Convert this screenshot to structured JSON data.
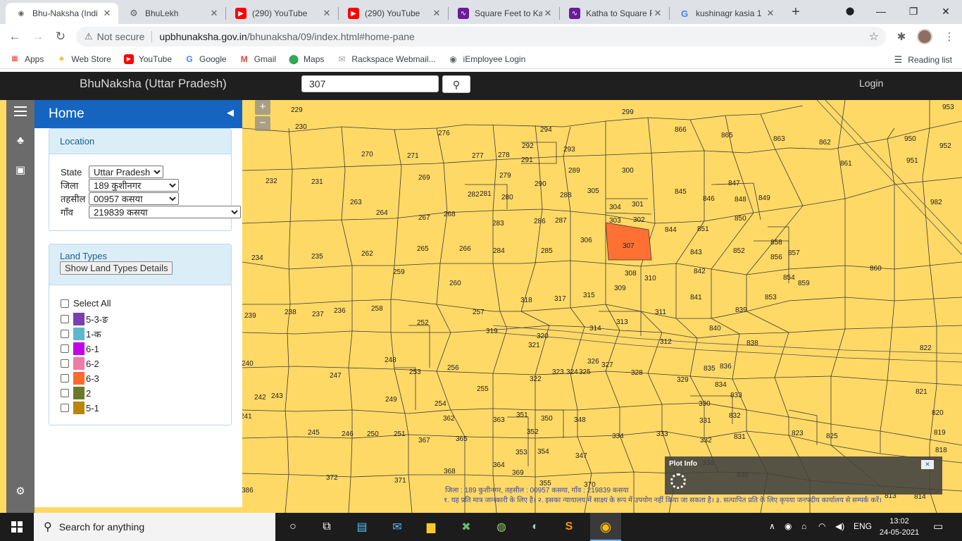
{
  "browser": {
    "tabs": [
      {
        "title": "Bhu-Naksha (Indi",
        "icon": "globe-icon",
        "color": "#5f6368"
      },
      {
        "title": "BhuLekh",
        "icon": "gear-icon",
        "color": "#5f6368"
      },
      {
        "title": "(290) YouTube",
        "icon": "youtube-icon",
        "color": "#ff0000"
      },
      {
        "title": "(290) YouTube",
        "icon": "youtube-icon",
        "color": "#ff0000"
      },
      {
        "title": "Square Feet to Ka",
        "icon": "converter-icon",
        "color": "#6a1b9a"
      },
      {
        "title": "Katha to Square F",
        "icon": "converter-icon",
        "color": "#6a1b9a"
      },
      {
        "title": "kushinagr kasia 1",
        "icon": "google-icon",
        "color": "#4285f4"
      }
    ],
    "address": {
      "security": "Not secure",
      "host": "upbhunaksha.gov.in",
      "path": "/bhunaksha/09/index.html#home-pane"
    },
    "bookmarks": [
      {
        "label": "Apps",
        "icon": "apps-grid-icon",
        "color": "#ea4335"
      },
      {
        "label": "Web Store",
        "icon": "webstore-icon",
        "color": "#f4b400"
      },
      {
        "label": "YouTube",
        "icon": "youtube-icon",
        "color": "#ff0000"
      },
      {
        "label": "Google",
        "icon": "google-icon",
        "color": "#4285f4"
      },
      {
        "label": "Gmail",
        "icon": "gmail-icon",
        "color": "#ea4335"
      },
      {
        "label": "Maps",
        "icon": "maps-icon",
        "color": "#34a853"
      },
      {
        "label": "Rackspace Webmail...",
        "icon": "mail-icon",
        "color": "#9e9e9e"
      },
      {
        "label": "iEmployee Login",
        "icon": "globe-icon",
        "color": "#5f6368"
      }
    ],
    "reading_list": "Reading list"
  },
  "app": {
    "title": "BhuNaksha (Uttar Pradesh)",
    "search_value": "307",
    "login": "Login"
  },
  "panel": {
    "title": "Home",
    "location": {
      "heading": "Location",
      "fields": [
        {
          "label": "State",
          "value": "Uttar Pradesh"
        },
        {
          "label": "जिला",
          "value": "189 कुशीनगर"
        },
        {
          "label": "तहसील",
          "value": "00957 कसया"
        },
        {
          "label": "गाँव",
          "value": "219839 कसया"
        }
      ]
    },
    "land_types": {
      "heading": "Land Types",
      "button": "Show Land Types Details",
      "select_all": "Select All",
      "items": [
        {
          "label": "5-3-ङ",
          "color": "#7b3fb0"
        },
        {
          "label": "1-क",
          "color": "#5bb8d0"
        },
        {
          "label": "6-1",
          "color": "#c400e8"
        },
        {
          "label": "6-2",
          "color": "#f07aa8"
        },
        {
          "label": "6-3",
          "color": "#ff6a2e"
        },
        {
          "label": "2",
          "color": "#6b7a2a"
        },
        {
          "label": "5-1",
          "color": "#b8860b"
        }
      ]
    }
  },
  "map": {
    "selected_plot": "307",
    "highlight_color": "#ff7033",
    "plot_numbers": [
      "229",
      "230",
      "276",
      "294",
      "299",
      "866",
      "865",
      "863",
      "862",
      "950",
      "952",
      "953",
      "951",
      "861",
      "232",
      "231",
      "270",
      "271",
      "269",
      "277",
      "278",
      "292",
      "291",
      "293",
      "289",
      "300",
      "263",
      "264",
      "267",
      "268",
      "282",
      "281",
      "279",
      "280",
      "290",
      "288",
      "305",
      "304",
      "303",
      "301",
      "302",
      "845",
      "846",
      "848",
      "849",
      "847",
      "850",
      "982",
      "234",
      "235",
      "262",
      "265",
      "266",
      "283",
      "284",
      "286",
      "287",
      "285",
      "306",
      "307",
      "844",
      "851",
      "843",
      "852",
      "858",
      "856",
      "857",
      "842",
      "854",
      "859",
      "860",
      "259",
      "260",
      "308",
      "310",
      "309",
      "239",
      "238",
      "237",
      "236",
      "258",
      "257",
      "252",
      "318",
      "317",
      "315",
      "313",
      "314",
      "311",
      "841",
      "839",
      "840",
      "853",
      "319",
      "320",
      "321",
      "322",
      "323",
      "324",
      "325",
      "326",
      "327",
      "312",
      "328",
      "329",
      "838",
      "835",
      "836",
      "834",
      "833",
      "822",
      "240",
      "242",
      "243",
      "247",
      "248",
      "249",
      "253",
      "256",
      "255",
      "254",
      "821",
      "820",
      "819",
      "818",
      "362",
      "363",
      "351",
      "350",
      "348",
      "330",
      "331",
      "332",
      "831",
      "832",
      "823",
      "825",
      "241",
      "245",
      "246",
      "250",
      "251",
      "367",
      "365",
      "352",
      "353",
      "354",
      "355",
      "364",
      "334",
      "333",
      "347",
      "336",
      "372",
      "371",
      "368",
      "369",
      "370",
      "386",
      "830",
      "813",
      "814"
    ],
    "zoom_in": "+",
    "zoom_out": "−",
    "plot_info_title": "Plot Info",
    "footer_line1": "जिला : 189 कुशीनगर, तहसील : 00957 कसया, गाँव : 219839 कसया",
    "footer_line2": "१. यह प्रति मात्र जानकारी के लिए है। २. इसका न्यायालय में साक्ष्य के रूप में उपयोग नहीं किया जा सकता है। ३. सत्यापित प्रति के लिए कृपया जनपदीय कार्यालय से सम्पर्क करें।"
  },
  "taskbar": {
    "search_placeholder": "Search for anything",
    "language": "ENG",
    "time": "13:02",
    "date": "24-05-2021"
  }
}
